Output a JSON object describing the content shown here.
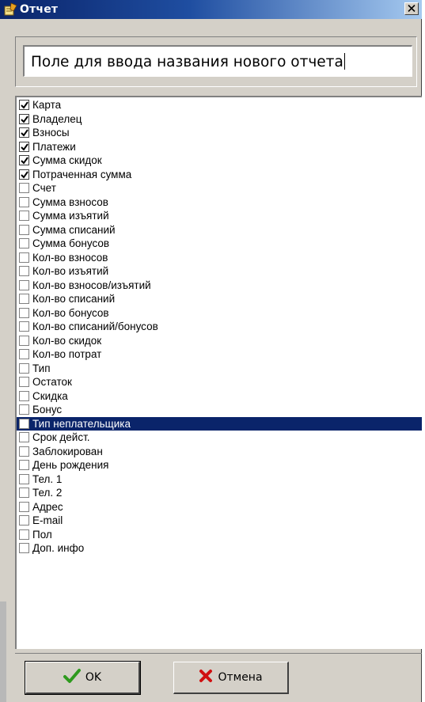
{
  "window": {
    "title": "Отчет",
    "icon": "report-pencil-icon",
    "close_icon": "close-x-icon"
  },
  "report_name_input": {
    "value": "Поле для ввода названия нового отчета"
  },
  "fields_list": {
    "selected_index": 24,
    "items": [
      {
        "label": "Карта",
        "checked": true
      },
      {
        "label": "Владелец",
        "checked": true
      },
      {
        "label": "Взносы",
        "checked": true
      },
      {
        "label": "Платежи",
        "checked": true
      },
      {
        "label": "Сумма скидок",
        "checked": true
      },
      {
        "label": "Потраченная сумма",
        "checked": true
      },
      {
        "label": "Счет",
        "checked": false
      },
      {
        "label": "Сумма взносов",
        "checked": false
      },
      {
        "label": "Сумма изъятий",
        "checked": false
      },
      {
        "label": "Сумма списаний",
        "checked": false
      },
      {
        "label": "Сумма бонусов",
        "checked": false
      },
      {
        "label": "Кол-во взносов",
        "checked": false
      },
      {
        "label": "Кол-во изъятий",
        "checked": false
      },
      {
        "label": "Кол-во взносов/изъятий",
        "checked": false
      },
      {
        "label": "Кол-во списаний",
        "checked": false
      },
      {
        "label": "Кол-во бонусов",
        "checked": false
      },
      {
        "label": "Кол-во списаний/бонусов",
        "checked": false
      },
      {
        "label": "Кол-во скидок",
        "checked": false
      },
      {
        "label": "Кол-во потрат",
        "checked": false
      },
      {
        "label": "Тип",
        "checked": false
      },
      {
        "label": "Остаток",
        "checked": false
      },
      {
        "label": "Скидка",
        "checked": false
      },
      {
        "label": "Бонус",
        "checked": false
      },
      {
        "label": "Тип неплательщика",
        "checked": false
      },
      {
        "label": "Срок дейст.",
        "checked": false
      },
      {
        "label": "Заблокирован",
        "checked": false
      },
      {
        "label": "День рождения",
        "checked": false
      },
      {
        "label": "Тел. 1",
        "checked": false
      },
      {
        "label": "Тел. 2",
        "checked": false
      },
      {
        "label": "Адрес",
        "checked": false
      },
      {
        "label": "E-mail",
        "checked": false
      },
      {
        "label": "Пол",
        "checked": false
      },
      {
        "label": "Доп. инфо",
        "checked": false
      }
    ]
  },
  "buttons": {
    "ok_label": "OK",
    "ok_icon": "green-checkmark-icon",
    "cancel_label": "Отмена",
    "cancel_icon": "red-x-icon"
  },
  "colors": {
    "titlebar_start": "#0a246a",
    "titlebar_end": "#a6caf0",
    "selection": "#0a246a",
    "ok_check": "#2e9a1e",
    "cancel_x": "#d01010"
  }
}
